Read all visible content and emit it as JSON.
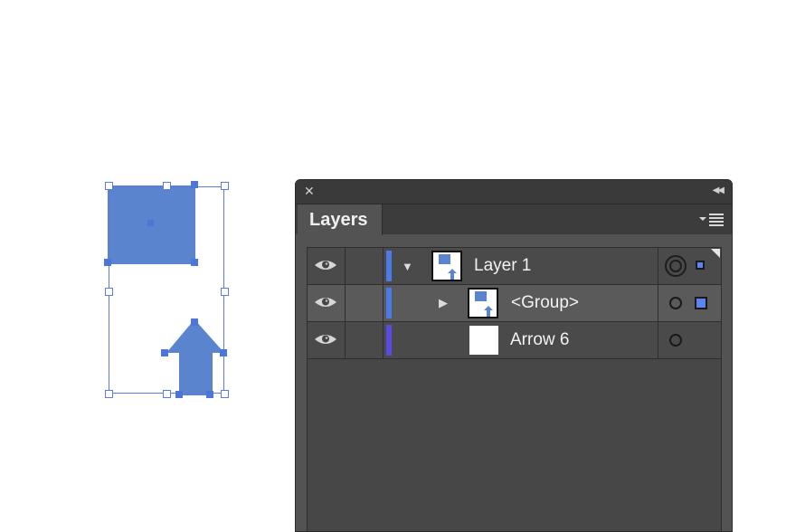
{
  "colors": {
    "art_fill": "#5b84cf",
    "selection": "#5b7be0",
    "layer_color": "#4b7be8",
    "arrow_color": "#5a4be8",
    "panel_bg": "#535353"
  },
  "panel": {
    "tab_label": "Layers",
    "close_icon": "close-icon",
    "collapse_icon": "double-chevron-left-icon",
    "menu_icon": "panel-menu-icon"
  },
  "layers": {
    "rows": [
      {
        "label": "Layer 1",
        "visible": true,
        "expanded": true,
        "selected": false
      },
      {
        "label": "<Group>",
        "visible": true,
        "expanded": false,
        "selected": true
      },
      {
        "label": "Arrow 6",
        "visible": true,
        "expanded": false,
        "selected": false
      }
    ]
  }
}
